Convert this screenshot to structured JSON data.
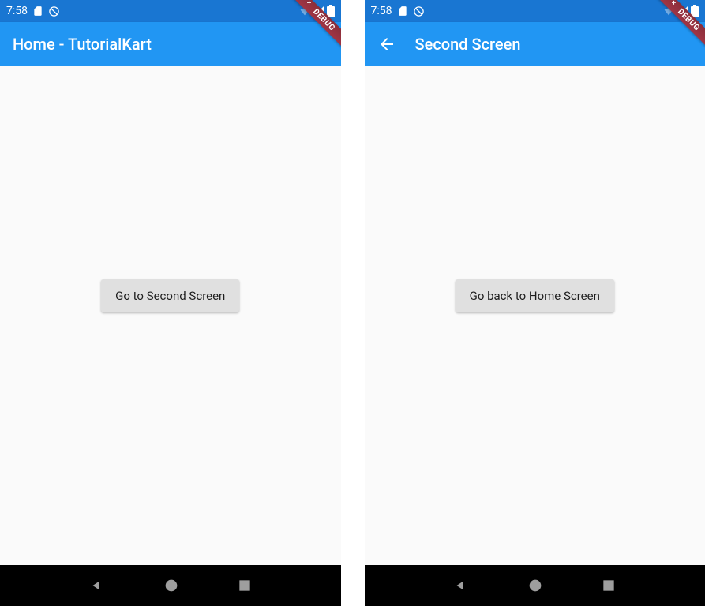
{
  "screens": [
    {
      "statusBar": {
        "time": "7:58"
      },
      "appBar": {
        "title": "Home - TutorialKart",
        "hasBack": false
      },
      "button": {
        "label": "Go to Second Screen"
      },
      "debugBanner": "DEBUG"
    },
    {
      "statusBar": {
        "time": "7:58"
      },
      "appBar": {
        "title": "Second Screen",
        "hasBack": true
      },
      "button": {
        "label": "Go back to Home Screen"
      },
      "debugBanner": "DEBUG"
    }
  ]
}
